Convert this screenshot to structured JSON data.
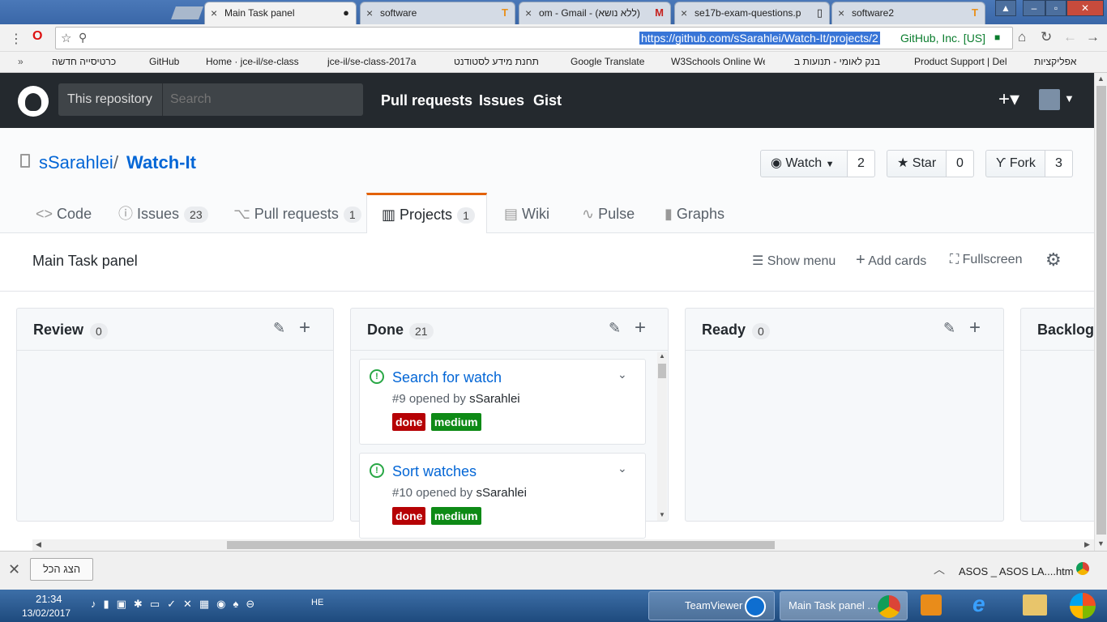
{
  "browser": {
    "tabs": [
      {
        "label": "Main Task panel",
        "favicon": "github-icon",
        "active": true
      },
      {
        "label": "software",
        "favicon": "t-icon"
      },
      {
        "label": "om - Gmail - (ללא נושא)",
        "favicon": "gmail-icon"
      },
      {
        "label": "se17b-exam-questions.p",
        "favicon": "doc-icon"
      },
      {
        "label": "software2",
        "favicon": "t-icon"
      }
    ],
    "url": "https://github.com/sSarahlei/Watch-It/projects/2",
    "cert": "GitHub, Inc. [US]",
    "bookmarks": [
      "כרטיסייה חדשה",
      "GitHub",
      "Home · jce-il/se-class",
      "jce-il/se-class-2017a",
      "תחנת מידע לסטודנט",
      "Google Translate",
      "W3Schools Online We",
      "בנק לאומי - תנועות ב",
      "Product Support | Del",
      "אפליקציות"
    ]
  },
  "github": {
    "scope_label": "This repository",
    "search_placeholder": "Search",
    "nav": [
      "Pull requests",
      "Issues",
      "Gist"
    ]
  },
  "repo": {
    "owner": "sSarahlei",
    "sep": "/",
    "name": "Watch-It",
    "watch_label": "Watch",
    "watch_count": "2",
    "star_label": "Star",
    "star_count": "0",
    "fork_label": "Fork",
    "fork_count": "3",
    "tabs": [
      {
        "label": "Code",
        "count": ""
      },
      {
        "label": "Issues",
        "count": "23"
      },
      {
        "label": "Pull requests",
        "count": "1"
      },
      {
        "label": "Projects",
        "count": "1"
      },
      {
        "label": "Wiki",
        "count": ""
      },
      {
        "label": "Pulse",
        "count": ""
      },
      {
        "label": "Graphs",
        "count": ""
      }
    ]
  },
  "project": {
    "title": "Main Task panel",
    "show_menu": "Show menu",
    "add_cards": "Add cards",
    "fullscreen": "Fullscreen",
    "columns": [
      {
        "name": "Review",
        "count": "0"
      },
      {
        "name": "Done",
        "count": "21"
      },
      {
        "name": "Ready",
        "count": "0"
      },
      {
        "name": "Backlog",
        "count": ""
      }
    ],
    "cards": [
      {
        "title": "Search for watch",
        "meta": "#9 opened by",
        "author": "sSarahlei",
        "labels": [
          {
            "text": "done",
            "color": "#b60205"
          },
          {
            "text": "medium",
            "color": "#0e8a16"
          }
        ]
      },
      {
        "title": "Sort watches",
        "meta": "#10 opened by",
        "author": "sSarahlei",
        "labels": [
          {
            "text": "done",
            "color": "#b60205"
          },
          {
            "text": "medium",
            "color": "#0e8a16"
          }
        ]
      }
    ]
  },
  "downloads": {
    "show_all": "הצג הכל",
    "file": "ASOS _ ASOS LA....htm"
  },
  "taskbar": {
    "time": "21:34",
    "date": "13/02/2017",
    "lang": "HE",
    "apps": [
      "TeamViewer",
      "Main Task panel ..."
    ]
  }
}
